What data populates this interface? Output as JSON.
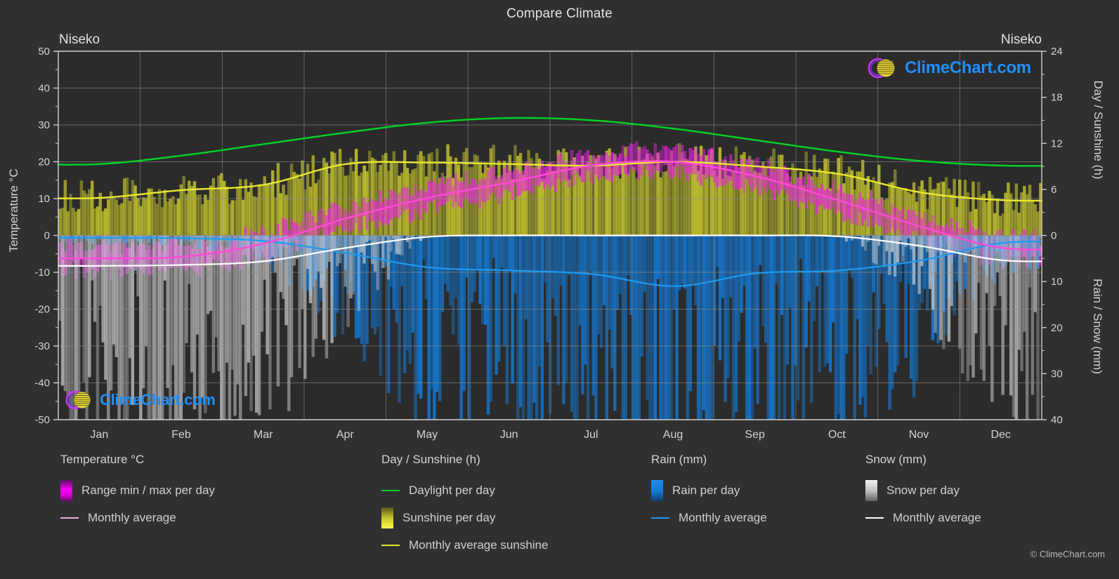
{
  "header": {
    "title": "Compare Climate",
    "station_left": "Niseko",
    "station_right": "Niseko"
  },
  "axes": {
    "y_left_title": "Temperature °C",
    "y_left_ticks": [
      "50",
      "40",
      "30",
      "20",
      "10",
      "0",
      "-10",
      "-20",
      "-30",
      "-40",
      "-50"
    ],
    "y_right_top_title": "Day / Sunshine (h)",
    "y_right_top_ticks": [
      "24",
      "18",
      "12",
      "6",
      "0"
    ],
    "y_right_bottom_title": "Rain / Snow (mm)",
    "y_right_bottom_ticks": [
      "0",
      "10",
      "20",
      "30",
      "40"
    ],
    "x_ticks": [
      "Jan",
      "Feb",
      "Mar",
      "Apr",
      "May",
      "Jun",
      "Jul",
      "Aug",
      "Sep",
      "Oct",
      "Nov",
      "Dec"
    ]
  },
  "legend": {
    "groups": [
      {
        "title": "Temperature °C",
        "items": [
          {
            "label": "Range min / max per day",
            "swatch": "gradient-box",
            "color": "#ff00ff"
          },
          {
            "label": "Monthly average",
            "swatch": "line",
            "color": "#f0a8e0"
          }
        ]
      },
      {
        "title": "Day / Sunshine (h)",
        "items": [
          {
            "label": "Daylight per day",
            "swatch": "line",
            "color": "#00d426"
          },
          {
            "label": "Sunshine per day",
            "swatch": "gradient-box",
            "color": "#e8e830"
          },
          {
            "label": "Monthly average sunshine",
            "swatch": "line",
            "color": "#e8e830"
          }
        ]
      },
      {
        "title": "Rain (mm)",
        "items": [
          {
            "label": "Rain per day",
            "swatch": "gradient-box",
            "color": "#1478d2"
          },
          {
            "label": "Monthly average",
            "swatch": "line",
            "color": "#2196f3"
          }
        ]
      },
      {
        "title": "Snow (mm)",
        "items": [
          {
            "label": "Snow per day",
            "swatch": "gradient-box",
            "color": "#e8e8e8"
          },
          {
            "label": "Monthly average",
            "swatch": "line",
            "color": "#ffffff"
          }
        ]
      }
    ],
    "copyright": "© ClimeChart.com"
  },
  "watermark": {
    "text": "ClimeChart.com"
  },
  "colors": {
    "background": "#303030",
    "plot_background": "#2b2b2b",
    "grid": "#9a9a9a",
    "axis": "#d0d0d0",
    "daylight": "#00d426",
    "sunshine": "#e8e830",
    "temperature_avg": "#ff49d6",
    "rain_avg": "#1e9bf0",
    "snow_avg": "#ffffff",
    "text": "#d4d4d4",
    "watermark_text": "#1e90ff",
    "logo_ring": "#cc33ff",
    "logo_sphere": "#e2d43c"
  },
  "chart_data": {
    "type": "line",
    "title": "Compare Climate",
    "xlabel": "",
    "ylabel": "Temperature °C",
    "ylim": [
      -50,
      50
    ],
    "y_right_top_lim": [
      0,
      24
    ],
    "y_right_bottom_lim": [
      0,
      40
    ],
    "grid": true,
    "legend_position": "bottom",
    "categories": [
      "Jan",
      "Feb",
      "Mar",
      "Apr",
      "May",
      "Jun",
      "Jul",
      "Aug",
      "Sep",
      "Oct",
      "Nov",
      "Dec"
    ],
    "x_fraction": [
      0.042,
      0.125,
      0.208,
      0.292,
      0.375,
      0.458,
      0.542,
      0.625,
      0.708,
      0.792,
      0.875,
      0.958
    ],
    "series": [
      {
        "name": "Daylight per day",
        "unit": "h",
        "axis": "right-top",
        "color": "#00d426",
        "values": [
          9.3,
          10.4,
          11.9,
          13.4,
          14.7,
          15.3,
          15.0,
          13.9,
          12.4,
          10.9,
          9.7,
          9.1
        ]
      },
      {
        "name": "Monthly average sunshine",
        "unit": "h",
        "axis": "right-top",
        "color": "#e8e830",
        "values": [
          4.9,
          5.9,
          6.6,
          9.3,
          9.5,
          9.3,
          9.1,
          9.6,
          9.0,
          8.0,
          5.6,
          4.6
        ]
      },
      {
        "name": "Monthly average temperature",
        "unit": "°C",
        "axis": "left",
        "color": "#ff49d6",
        "values": [
          -6.2,
          -5.8,
          -2.2,
          4.6,
          10.2,
          14.5,
          19.0,
          20.0,
          16.0,
          9.5,
          2.4,
          -3.4
        ]
      },
      {
        "name": "Monthly average rain",
        "unit": "mm",
        "axis": "right-bottom",
        "color": "#1e9bf0",
        "values": [
          0.5,
          0.6,
          1.2,
          3.8,
          6.9,
          7.6,
          8.4,
          11.0,
          8.2,
          7.6,
          5.4,
          1.6
        ]
      },
      {
        "name": "Monthly average snow",
        "unit": "mm",
        "axis": "right-bottom",
        "color": "#ffffff",
        "values": [
          6.6,
          6.4,
          5.6,
          2.7,
          0.3,
          0.0,
          0.0,
          0.0,
          0.0,
          0.2,
          2.3,
          5.4
        ]
      }
    ],
    "daily_bands": [
      {
        "name": "Range min / max per day",
        "color": "#ff00ff",
        "axis": "left",
        "description": "Magenta vertical daily min/max temperature bars"
      },
      {
        "name": "Sunshine per day",
        "color": "#e8e830",
        "axis": "right-top",
        "description": "Yellow vertical daily sunshine hour bars"
      },
      {
        "name": "Rain per day",
        "color": "#1478d2",
        "axis": "right-bottom",
        "description": "Blue vertical daily rainfall bars below zero line"
      },
      {
        "name": "Snow per day",
        "color": "#e8e8e8",
        "axis": "right-bottom",
        "description": "Grey/white vertical daily snowfall bars below zero line"
      }
    ]
  }
}
